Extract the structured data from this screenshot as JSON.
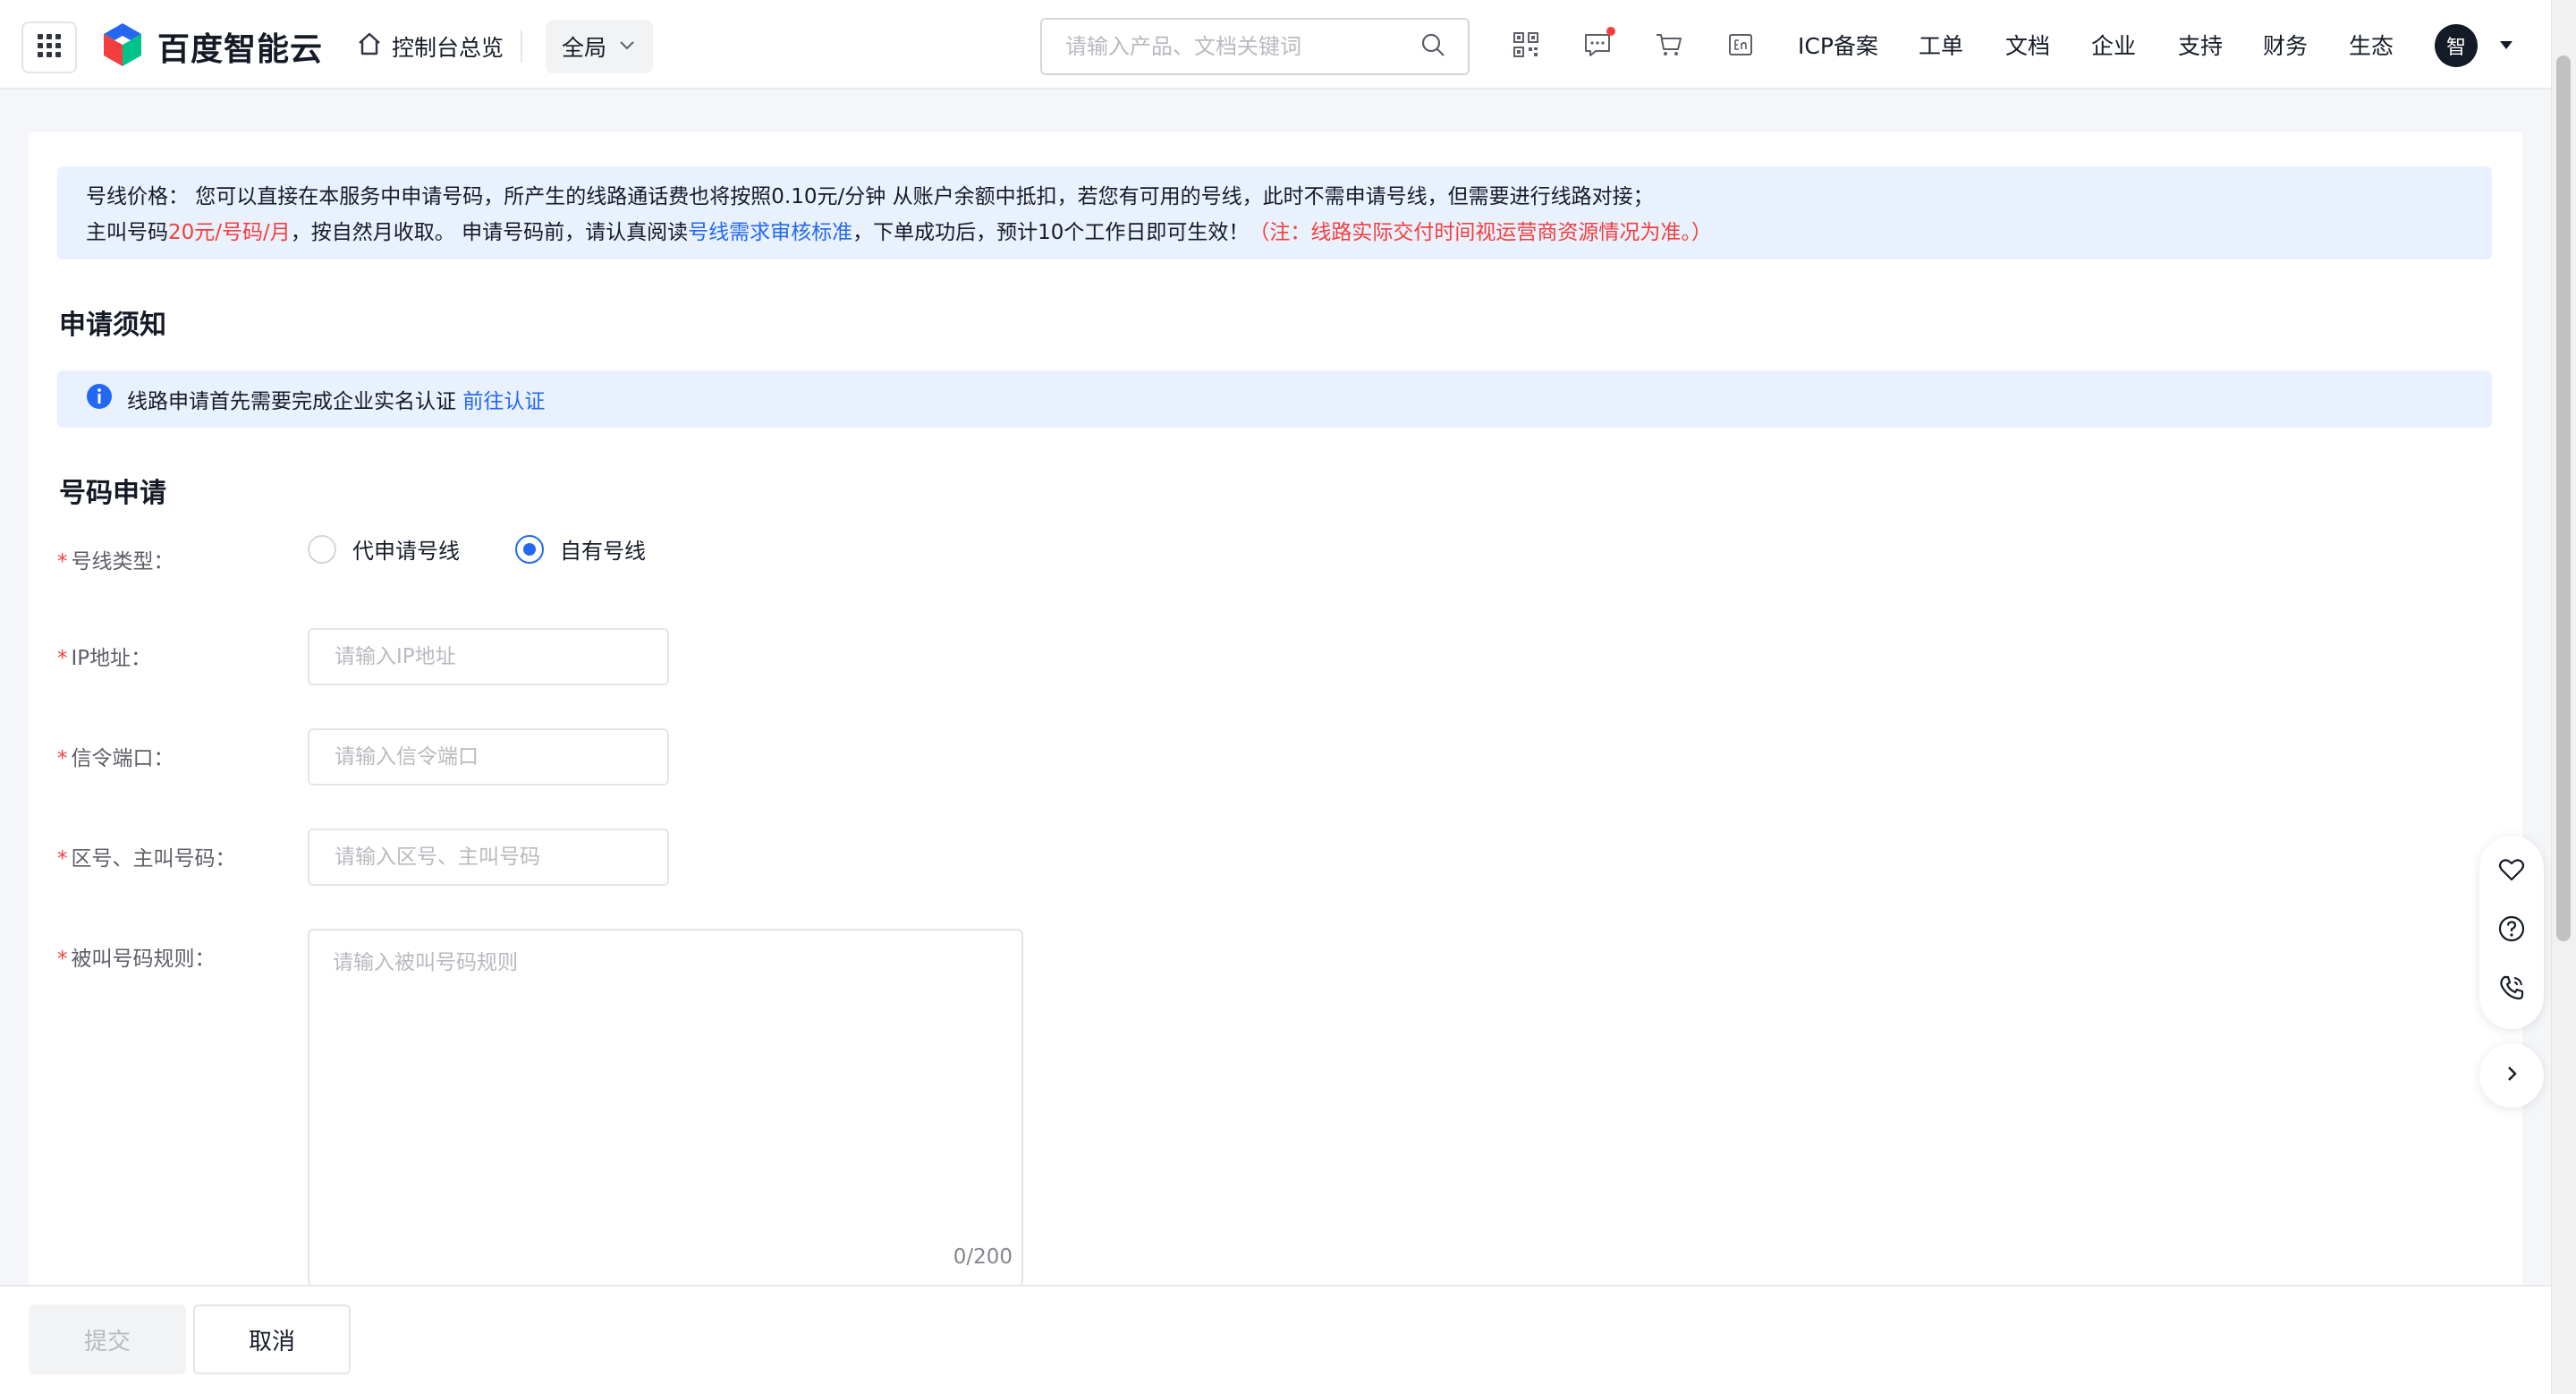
{
  "header": {
    "logo_text": "百度智能云",
    "home_label": "控制台总览",
    "scope_label": "全局",
    "search_placeholder": "请输入产品、文档关键词",
    "nav": [
      "ICP备案",
      "工单",
      "文档",
      "企业",
      "支持",
      "财务",
      "生态"
    ],
    "avatar_text": "智"
  },
  "notice": {
    "line1": "号线价格：  您可以直接在本服务中申请号码，所产生的线路通话费也将按照0.10元/分钟 从账户余额中抵扣，若您有可用的号线，此时不需申请号线，但需要进行线路对接；",
    "line2_a": "主叫号码",
    "line2_price": "20元/号码/月",
    "line2_b": "，按自然月收取。 申请号码前，请认真阅读",
    "line2_link": "号线需求审核标准",
    "line2_c": "，下单成功后，预计10个工作日即可生效！",
    "line2_note": "（注：线路实际交付时间视运营商资源情况为准。）"
  },
  "sections": {
    "apply_notice_title": "申请须知",
    "info_text": "线路申请首先需要完成企业实名认证",
    "info_link": "前往认证",
    "number_apply_title": "号码申请"
  },
  "form": {
    "line_type_label": "号线类型：",
    "radio_options": [
      "代申请号线",
      "自有号线"
    ],
    "selected_option": "自有号线",
    "ip_label": "IP地址：",
    "ip_placeholder": "请输入IP地址",
    "port_label": "信令端口：",
    "port_placeholder": "请输入信令端口",
    "area_label": "区号、主叫号码：",
    "area_placeholder": "请输入区号、主叫号码",
    "rule_label": "被叫号码规则：",
    "rule_placeholder": "请输入被叫号码规则",
    "rule_counter": "0/200"
  },
  "footer": {
    "submit_label": "提交",
    "cancel_label": "取消"
  },
  "colors": {
    "accent": "#2468f2",
    "danger": "#f33e3e",
    "notice_bg": "#e9f1fd"
  }
}
